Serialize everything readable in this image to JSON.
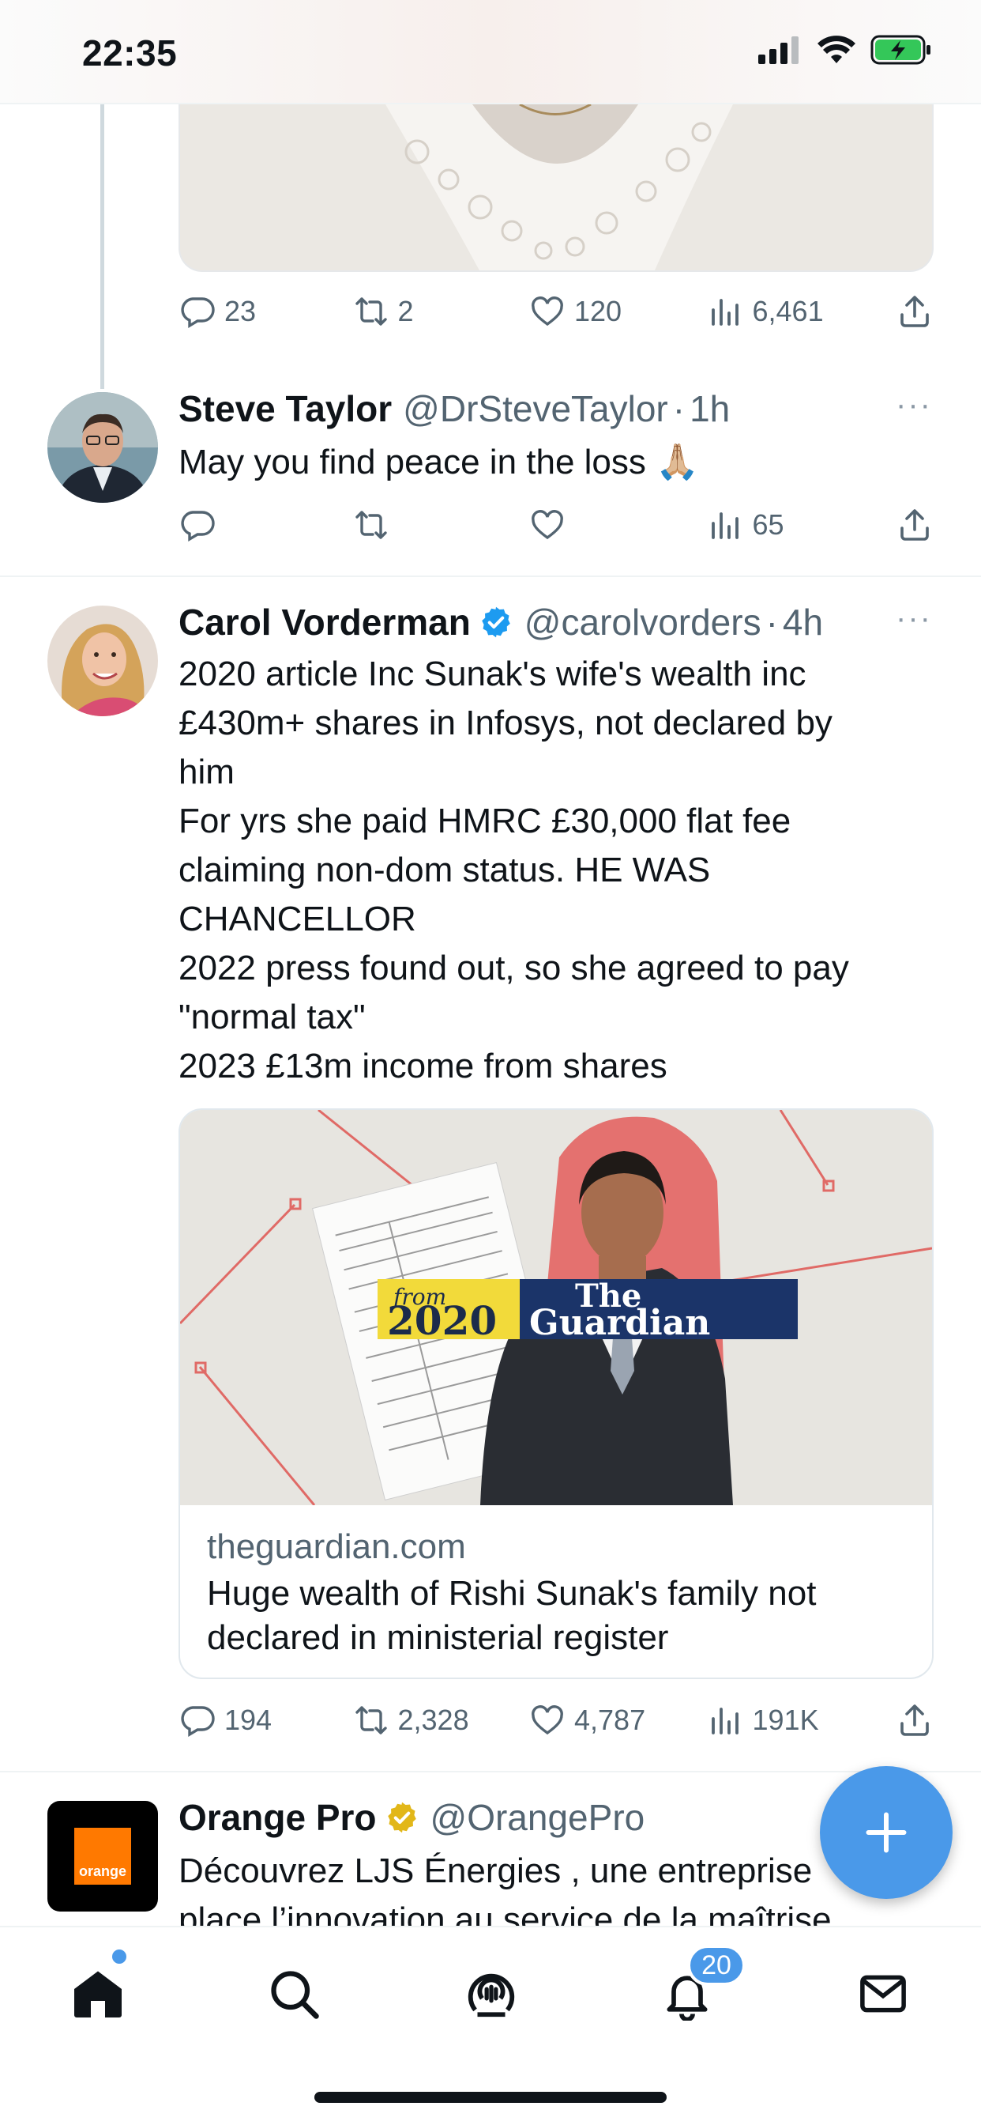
{
  "status_bar": {
    "time": "22:35"
  },
  "tweet_prev": {
    "replies": "23",
    "retweets": "2",
    "likes": "120",
    "views": "6,461"
  },
  "reply": {
    "name": "Steve Taylor",
    "handle": "@DrSteveTaylor",
    "sep": "·",
    "time": "1h",
    "text": "May you find peace in the loss 🙏🏼",
    "views": "65",
    "more": "···"
  },
  "main_tweet": {
    "name": "Carol Vorderman",
    "handle": "@carolvorders",
    "sep": "·",
    "time": "4h",
    "more": "···",
    "text": "2020 article Inc Sunak's wife's wealth inc\n£430m+ shares in Infosys, not declared by\nhim\nFor yrs she paid HMRC £30,000 flat fee\nclaiming non-dom status. HE WAS\nCHANCELLOR\n2022 press found out, so she agreed to pay\n\"normal tax\"\n2023 £13m income from shares",
    "card": {
      "from": "from",
      "year": "2020",
      "brand_line1": "The",
      "brand_line2": "Guardian",
      "domain": "theguardian.com",
      "title": "Huge wealth of Rishi Sunak's family not declared in ministerial register"
    },
    "replies": "194",
    "retweets": "2,328",
    "likes": "4,787",
    "views": "191K"
  },
  "promo_tweet": {
    "name": "Orange Pro",
    "handle": "@OrangePro",
    "logo_text": "orange",
    "text_line1": "Découvrez LJS Énergies , une entreprise",
    "text_line2": "place l’innovation au service de la maîtrise"
  },
  "tab_bar": {
    "notifications_count": "20",
    "items": [
      "home-icon",
      "search-icon",
      "spaces-icon",
      "notifications-icon",
      "messages-icon"
    ]
  },
  "colors": {
    "accent": "#4a99e9",
    "muted": "#536471",
    "verified_blue": "#1d9bf0",
    "verified_gold": "#e2b719",
    "orange": "#ff7900"
  }
}
